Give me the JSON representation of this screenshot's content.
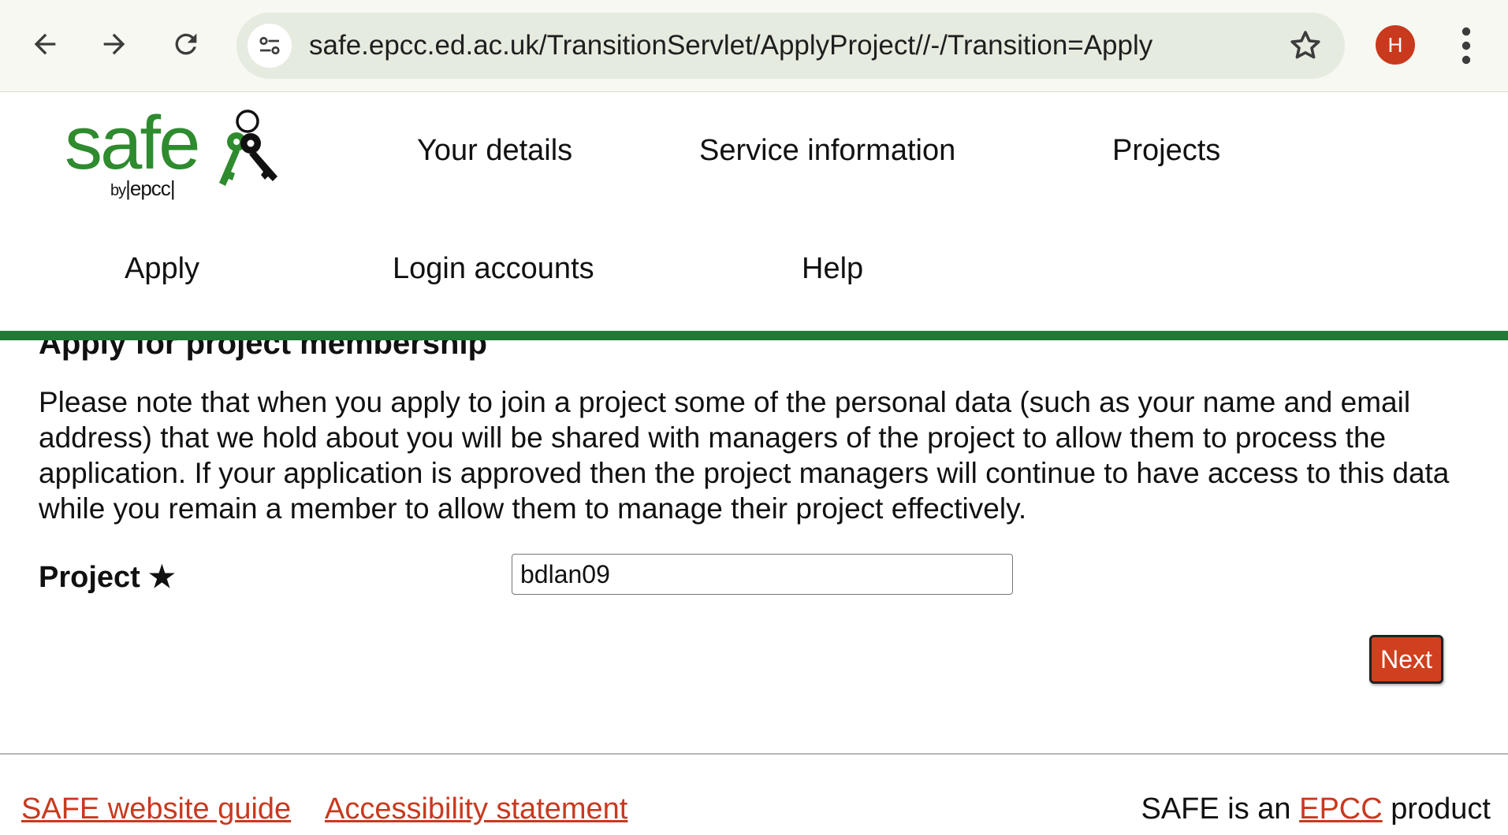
{
  "browser": {
    "url": "safe.epcc.ed.ac.uk/TransitionServlet/ApplyProject//-/Transition=Apply",
    "profile_initial": "H",
    "icons": [
      "back-arrow-icon",
      "forward-arrow-icon",
      "reload-icon",
      "site-info-icon",
      "bookmark-star-icon",
      "kebab-menu-icon"
    ]
  },
  "logo": {
    "word": "safe",
    "by": "by",
    "org": "epcc"
  },
  "nav": {
    "items": [
      "Your details",
      "Service information",
      "Projects",
      "Apply",
      "Login accounts",
      "Help"
    ]
  },
  "main": {
    "title": "Apply for project membership",
    "notice": "Please note that when you apply to join a project some of the personal data (such as your name and email address) that we hold about you will be shared with managers of the project to allow them to process the application. If your application is approved then the project managers will continue to have access to this data while you remain a member to allow them to manage their project effectively.",
    "project_label": "Project ★",
    "project_value": "bdlan09",
    "next_label": "Next"
  },
  "footer": {
    "links": [
      "SAFE website guide",
      "Accessibility statement"
    ],
    "tagline_prefix": "SAFE is an ",
    "tagline_link": "EPCC",
    "tagline_suffix": " product"
  },
  "colors": {
    "brand_green": "#2e8b2e",
    "bar_green": "#1f7a35",
    "accent_red": "#c9391e",
    "button_red": "#d0401e"
  }
}
